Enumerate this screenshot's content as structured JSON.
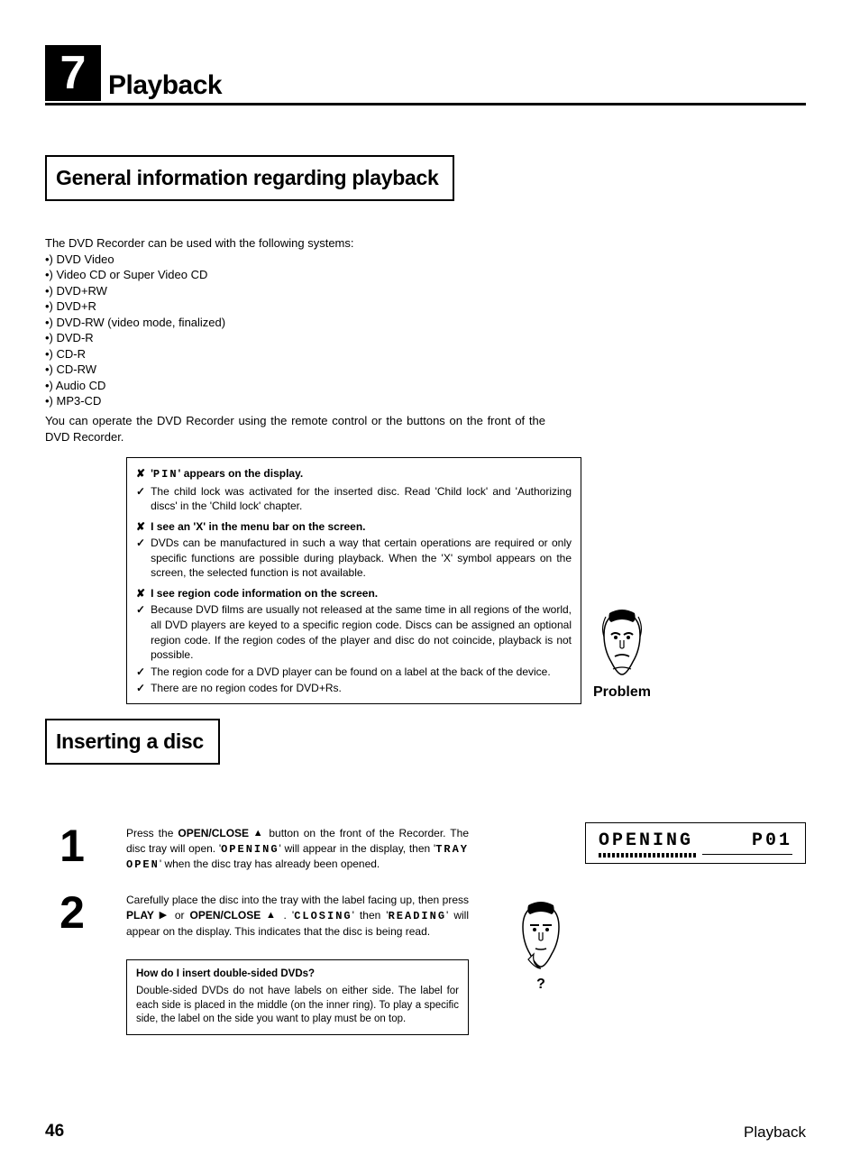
{
  "chapter": {
    "num": "7",
    "title": "Playback"
  },
  "section1": {
    "title": "General information regarding playback",
    "intro": "The DVD Recorder can be used with the following systems:",
    "bullets": [
      "•) DVD Video",
      "•) Video CD or Super Video CD",
      "•) DVD+RW",
      "•) DVD+R",
      "•) DVD-RW (video mode, finalized)",
      "•) DVD-R",
      "•) CD-R",
      "•) CD-RW",
      "•) Audio CD",
      "•) MP3-CD"
    ],
    "outro": "You can operate the DVD Recorder using the remote control or the buttons on the front of the DVD Recorder."
  },
  "problem": {
    "label": "Problem",
    "items": [
      {
        "mark": "✘",
        "head": true,
        "parts": [
          "'",
          "PIN",
          "' appears on the display."
        ]
      },
      {
        "mark": "✓",
        "head": false,
        "text": "The child lock was activated for the inserted disc. Read 'Child lock' and 'Authorizing discs' in the 'Child lock' chapter."
      },
      {
        "mark": "✘",
        "head": true,
        "text": "I see an 'X' in the menu bar on the screen."
      },
      {
        "mark": "✓",
        "head": false,
        "text": "DVDs can be manufactured in such a way that certain operations are required or only specific functions are possible during playback. When the 'X' symbol appears on the screen, the selected function is not available."
      },
      {
        "mark": "✘",
        "head": true,
        "text": "I see region code information on the screen."
      },
      {
        "mark": "✓",
        "head": false,
        "text": "Because DVD films are usually not released at the same time in all regions of the world, all DVD players are keyed to a specific region code. Discs can be assigned an optional region code. If the region codes of the player and disc do not coincide, playback is not possible."
      },
      {
        "mark": "✓",
        "head": false,
        "text": "The region code for a DVD player can be found on a label at the back of the device."
      },
      {
        "mark": "✓",
        "head": false,
        "text": "There are no region codes for DVD+Rs."
      }
    ]
  },
  "section2": {
    "title": "Inserting a disc"
  },
  "steps": {
    "s1": {
      "num": "1",
      "pre": "Press the ",
      "btn1": "OPEN/CLOSE",
      "mid1": " button on the front of the Recorder. The disc tray will open. '",
      "seg1": "OPENING",
      "mid2": "' will appear in the display, then '",
      "seg2": "TRAY OPEN",
      "end": "' when the disc tray has already been opened."
    },
    "s2": {
      "num": "2",
      "pre": "Carefully place the disc into the tray with the label facing up, then press ",
      "btn1": "PLAY",
      "mid1": " or ",
      "btn2": "OPEN/CLOSE",
      "mid2": " . '",
      "seg1": "CLOSING",
      "mid3": "' then '",
      "seg2": "READING",
      "end": "' will appear on the display. This indicates that the disc is being read."
    }
  },
  "lcd": {
    "left": "OPENING",
    "right": "P01"
  },
  "qbox": {
    "title": "How do I insert double-sided DVDs?",
    "body": "Double-sided DVDs do not have labels on either side. The label for each side is placed in the middle (on the inner ring). To play a specific side, the label on the side you want to play must be on top.",
    "mark": "?"
  },
  "footer": {
    "page": "46",
    "title": "Playback"
  }
}
